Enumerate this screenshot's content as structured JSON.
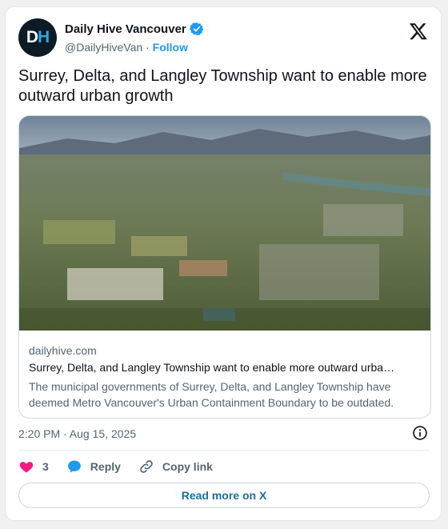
{
  "tweet": {
    "author_name": "Daily Hive Vancouver",
    "avatar_text_d": "D",
    "avatar_text_h": "H",
    "handle": "@DailyHiveVan",
    "separator": "·",
    "follow_label": "Follow",
    "text": "Surrey, Delta, and Langley Township want to enable more outward urban growth",
    "timestamp": "2:20 PM · Aug 15, 2025"
  },
  "link_card": {
    "domain": "dailyhive.com",
    "title": "Surrey, Delta, and Langley Township want to enable more outward urba…",
    "description": "The municipal governments of Surrey, Delta, and Langley Township have deemed Metro Vancouver's Urban Containment Boundary to be outdated."
  },
  "actions": {
    "like_count": "3",
    "reply_label": "Reply",
    "copy_link_label": "Copy link"
  },
  "read_more_label": "Read more on X",
  "colors": {
    "accent": "#1d9bf0",
    "like": "#f91880",
    "muted": "#536471"
  }
}
